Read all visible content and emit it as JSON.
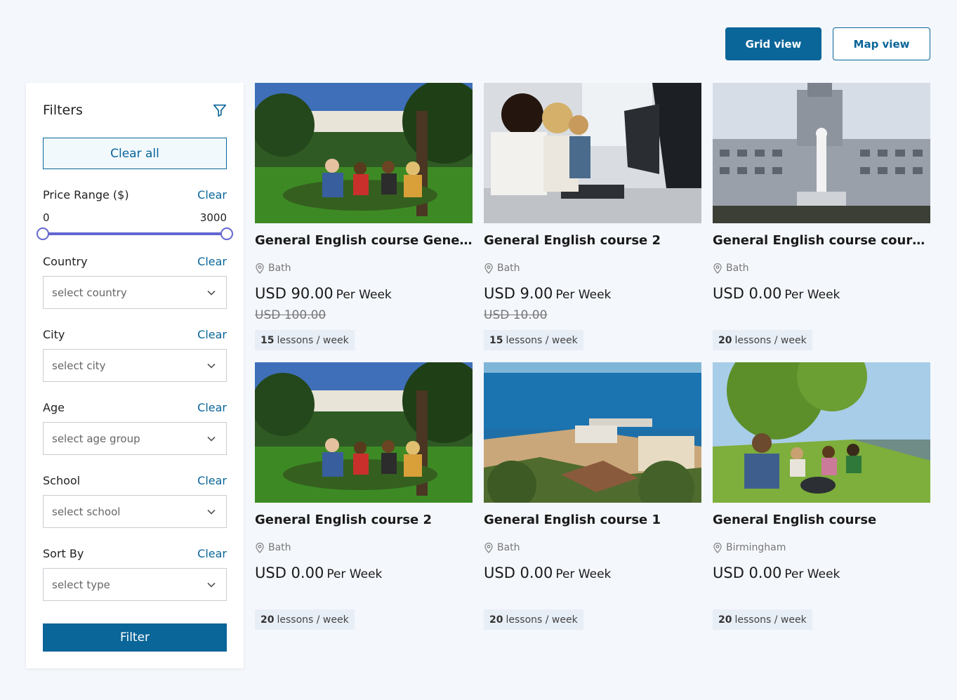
{
  "view_toggle": {
    "grid_label": "Grid view",
    "map_label": "Map view"
  },
  "filters": {
    "title": "Filters",
    "clear_all": "Clear all",
    "price": {
      "label": "Price Range ($)",
      "clear": "Clear",
      "min": "0",
      "max": "3000"
    },
    "country": {
      "label": "Country",
      "clear": "Clear",
      "placeholder": "select country"
    },
    "city": {
      "label": "City",
      "clear": "Clear",
      "placeholder": "select city"
    },
    "age": {
      "label": "Age",
      "clear": "Clear",
      "placeholder": "select age group"
    },
    "school": {
      "label": "School",
      "clear": "Clear",
      "placeholder": "select school"
    },
    "sort": {
      "label": "Sort By",
      "clear": "Clear",
      "placeholder": "select type"
    },
    "filter_button": "Filter"
  },
  "courses": [
    {
      "title": "General English course General English",
      "location": "Bath",
      "price": "USD 90.00",
      "per": "Per Week",
      "old_price": "USD 100.00",
      "lessons": "15",
      "lessons_unit": "lessons / week",
      "image": "park-students"
    },
    {
      "title": "General English course 2",
      "location": "Bath",
      "price": "USD 9.00",
      "per": "Per Week",
      "old_price": "USD 10.00",
      "lessons": "15",
      "lessons_unit": "lessons / week",
      "image": "computer-lab"
    },
    {
      "title": "General English course course course",
      "location": "Bath",
      "price": "USD 0.00",
      "per": "Per Week",
      "old_price": "",
      "lessons": "20",
      "lessons_unit": "lessons / week",
      "image": "university-building"
    },
    {
      "title": "General English course 2",
      "location": "Bath",
      "price": "USD 0.00",
      "per": "Per Week",
      "old_price": "",
      "lessons": "20",
      "lessons_unit": "lessons / week",
      "image": "park-students"
    },
    {
      "title": "General English course 1",
      "location": "Bath",
      "price": "USD 0.00",
      "per": "Per Week",
      "old_price": "",
      "lessons": "20",
      "lessons_unit": "lessons / week",
      "image": "seaside-pier"
    },
    {
      "title": "General English course",
      "location": "Birmingham",
      "price": "USD 0.00",
      "per": "Per Week",
      "old_price": "",
      "lessons": "20",
      "lessons_unit": "lessons / week",
      "image": "riverside-students"
    }
  ],
  "colors": {
    "primary": "#0a6599",
    "slider": "#6366d1",
    "background": "#f4f7fc"
  }
}
